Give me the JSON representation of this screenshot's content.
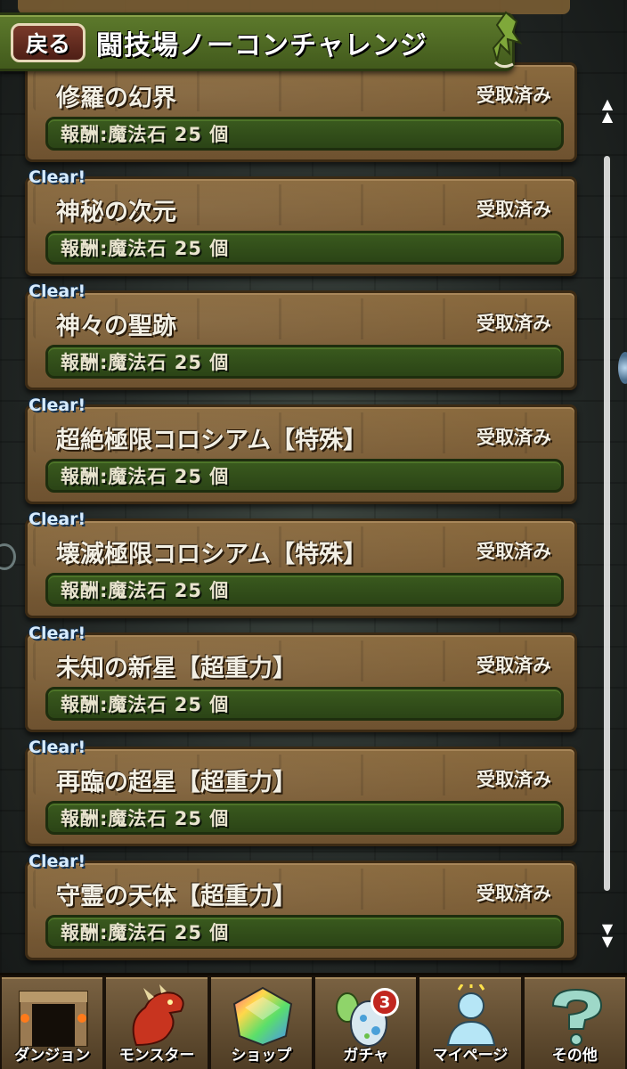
{
  "header": {
    "back_label": "戻る",
    "title": "闘技場ノーコンチャレンジ"
  },
  "quests": [
    {
      "clear": "",
      "name": "修羅の幻界",
      "status": "受取済み",
      "reward": "報酬:魔法石 25 個"
    },
    {
      "clear": "Clear!",
      "name": "神秘の次元",
      "status": "受取済み",
      "reward": "報酬:魔法石 25 個"
    },
    {
      "clear": "Clear!",
      "name": "神々の聖跡",
      "status": "受取済み",
      "reward": "報酬:魔法石 25 個"
    },
    {
      "clear": "Clear!",
      "name": "超絶極限コロシアム【特殊】",
      "status": "受取済み",
      "reward": "報酬:魔法石 25 個"
    },
    {
      "clear": "Clear!",
      "name": "壊滅極限コロシアム【特殊】",
      "status": "受取済み",
      "reward": "報酬:魔法石 25 個"
    },
    {
      "clear": "Clear!",
      "name": "未知の新星【超重力】",
      "status": "受取済み",
      "reward": "報酬:魔法石 25 個"
    },
    {
      "clear": "Clear!",
      "name": "再臨の超星【超重力】",
      "status": "受取済み",
      "reward": "報酬:魔法石 25 個"
    },
    {
      "clear": "Clear!",
      "name": "守霊の天体【超重力】",
      "status": "受取済み",
      "reward": "報酬:魔法石 25 個"
    }
  ],
  "nav": {
    "items": [
      {
        "label": "ダンジョン",
        "icon": "dungeon-gate-icon"
      },
      {
        "label": "モンスター",
        "icon": "red-dragon-icon"
      },
      {
        "label": "ショップ",
        "icon": "rainbow-gem-icon"
      },
      {
        "label": "ガチャ",
        "icon": "egg-icon",
        "badge": "3"
      },
      {
        "label": "マイページ",
        "icon": "player-icon"
      },
      {
        "label": "その他",
        "icon": "question-mark-icon"
      }
    ]
  },
  "colors": {
    "header_green": "#4f6b24",
    "panel_brown": "#7a5d36",
    "reward_green": "#2f4a18",
    "clear_blue": "#d7ecff",
    "badge_red": "#c1261f"
  }
}
